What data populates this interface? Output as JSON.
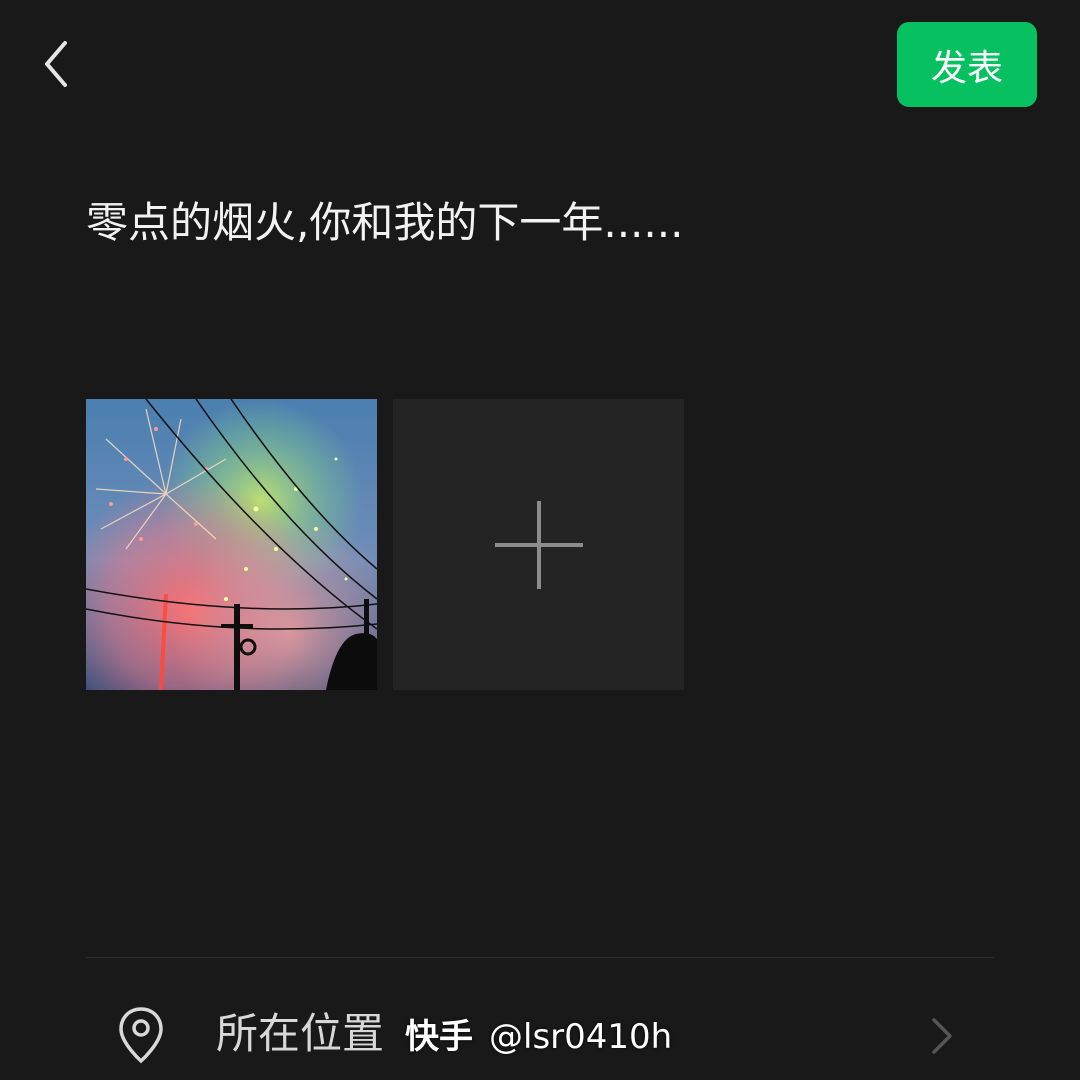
{
  "header": {
    "back_icon": "chevron-left-icon",
    "publish_label": "发表"
  },
  "post": {
    "text": "零点的烟火,你和我的下一年......",
    "photos": [
      {
        "subject": "fireworks over power lines at dusk"
      }
    ],
    "add_photo_icon": "plus-icon"
  },
  "location": {
    "icon": "location-pin-icon",
    "label": "所在位置",
    "chevron_icon": "chevron-right-icon"
  },
  "watermark": {
    "brand": "快手",
    "handle": "@lsr0410h"
  },
  "colors": {
    "background": "#191919",
    "accent": "#07c160",
    "tile": "#242424"
  }
}
